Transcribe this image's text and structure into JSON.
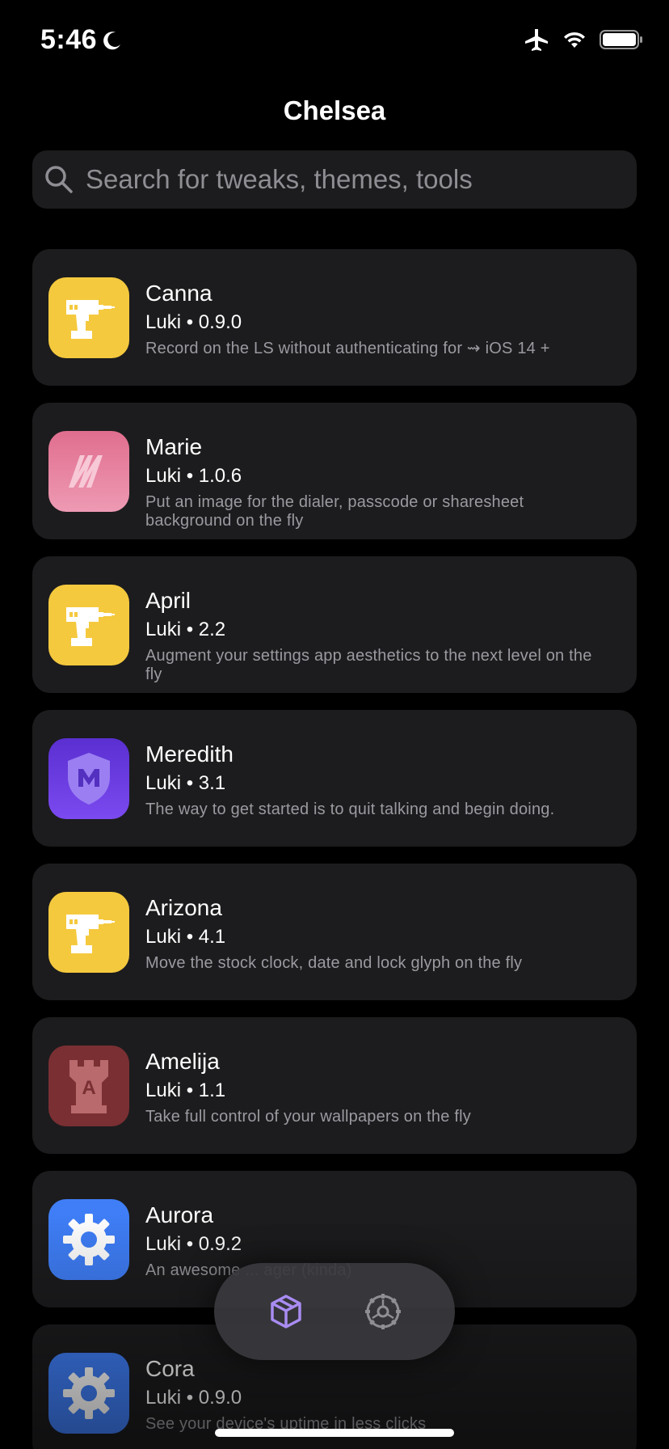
{
  "status_bar": {
    "time": "5:46",
    "icons": [
      "moon-icon",
      "airplane-icon",
      "wifi-icon",
      "battery-icon"
    ]
  },
  "nav": {
    "title": "Chelsea"
  },
  "search": {
    "placeholder": "Search for tweaks, themes, tools",
    "icon": "search-icon"
  },
  "packages": [
    {
      "name": "Canna",
      "meta": "Luki • 0.9.0",
      "description": "Record on the LS without authenticating for ⇝ iOS 14 +",
      "icon": "drill-icon",
      "icon_bg": "#f5c93e"
    },
    {
      "name": "Marie",
      "meta": "Luki • 1.0.6",
      "description": "Put an image for the dialer, passcode or sharesheet background on the fly",
      "icon": "marie-logo-icon",
      "icon_bg": "#e17a98"
    },
    {
      "name": "April",
      "meta": "Luki • 2.2",
      "description": "Augment your settings app aesthetics to the next level on the fly",
      "icon": "drill-icon",
      "icon_bg": "#f5c93e"
    },
    {
      "name": "Meredith",
      "meta": "Luki • 3.1",
      "description": "The way to get started is to quit talking and begin doing.",
      "icon": "shield-m-icon",
      "icon_bg": "#6a3be0"
    },
    {
      "name": "Arizona",
      "meta": "Luki • 4.1",
      "description": "Move the stock clock, date and lock glyph on the fly",
      "icon": "drill-icon",
      "icon_bg": "#f5c93e"
    },
    {
      "name": "Amelija",
      "meta": "Luki • 1.1",
      "description": "Take full control of your wallpapers on the fly",
      "icon": "tower-icon",
      "icon_bg": "#7a2f33"
    },
    {
      "name": "Aurora",
      "meta": "Luki • 0.9.2",
      "description": "An awesome ... ager (kinda)",
      "icon": "gear-icon",
      "icon_bg": "#3f7ef7"
    },
    {
      "name": "Cora",
      "meta": "Luki • 0.9.0",
      "description": "See your device's uptime in less clicks",
      "icon": "gear-icon",
      "icon_bg": "#3f7ef7"
    }
  ],
  "tab_bar": {
    "tabs": [
      {
        "icon": "package-icon",
        "active": true
      },
      {
        "icon": "settings-icon",
        "active": false
      }
    ],
    "active_color": "#a98cf2",
    "inactive_color": "#8e8e93"
  }
}
